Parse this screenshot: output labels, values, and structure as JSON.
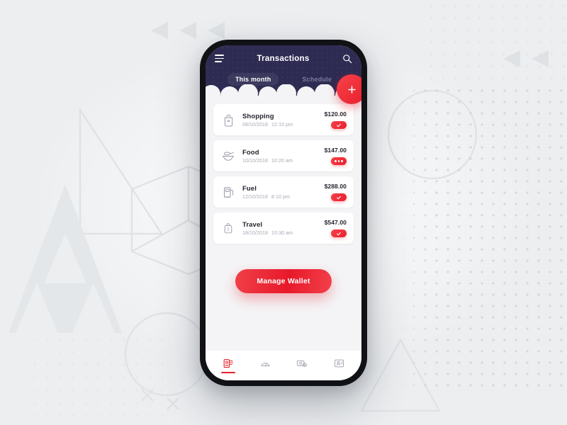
{
  "app": {
    "header": {
      "title": "Transactions",
      "menu_icon": "hamburger-menu-icon",
      "search_icon": "search-icon",
      "bg_color": "#2e2b52"
    },
    "tabs": [
      {
        "label": "This month",
        "active": true
      },
      {
        "label": "Schedule",
        "active": false
      }
    ],
    "fab": {
      "label": "+",
      "name": "add-transaction-fab",
      "color": "#e81f2c"
    },
    "transactions": [
      {
        "icon": "shopping-bag-icon",
        "title": "Shopping",
        "date": "08/10/2018",
        "time": "12:10 pm",
        "amount": "$120.00",
        "status": "completed"
      },
      {
        "icon": "food-bowl-icon",
        "title": "Food",
        "date": "10/10/2018",
        "time": "10:20 am",
        "amount": "$147.00",
        "status": "pending"
      },
      {
        "icon": "fuel-pump-icon",
        "title": "Fuel",
        "date": "12/10/2018",
        "time": "8:10 pm",
        "amount": "$288.00",
        "status": "completed"
      },
      {
        "icon": "suitcase-icon",
        "title": "Travel",
        "date": "18/10/2018",
        "time": "10:30 am",
        "amount": "$547.00",
        "status": "completed"
      }
    ],
    "cta": {
      "label": "Manage Wallet",
      "color": "#e81f2c"
    },
    "bottom_nav": [
      {
        "icon": "bill-receipt-icon",
        "active": true
      },
      {
        "icon": "speedometer-icon",
        "active": false
      },
      {
        "icon": "wallet-icon",
        "active": false
      },
      {
        "icon": "contact-card-icon",
        "active": false
      }
    ],
    "accent_color": "#e81f2c"
  }
}
